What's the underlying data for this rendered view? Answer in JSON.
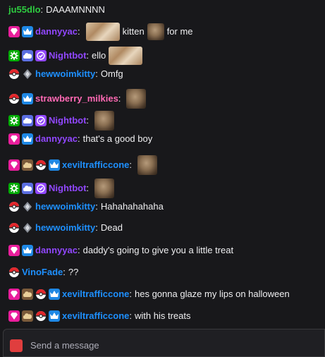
{
  "colors": {
    "background": "#18181b",
    "name_green": "#2ecc40",
    "name_purple": "#9147ff",
    "name_blue": "#1e90ff",
    "name_pink": "#ff69b4",
    "badge_pink": "#e91e9c",
    "badge_blue": "#1e88e5",
    "badge_green": "#00ad03",
    "badge_violet": "#9147ff"
  },
  "messages": [
    {
      "user": "ju55dlo",
      "color": "#2ecc40",
      "badges": [],
      "parts": [
        {
          "t": "text",
          "v": "DAAAMNNNN"
        }
      ]
    },
    {
      "user": "dannyyac",
      "color": "#9147ff",
      "badges": [
        "prime-gem",
        "crown"
      ],
      "parts": [
        {
          "t": "emote",
          "v": "wide"
        },
        {
          "t": "text",
          "v": "kitten"
        },
        {
          "t": "emote",
          "v": "small"
        },
        {
          "t": "text",
          "v": "for me"
        }
      ]
    },
    {
      "user": "Nightbot",
      "color": "#9147ff",
      "badges": [
        "moderator",
        "cloud",
        "verified"
      ],
      "parts": [
        {
          "t": "text",
          "v": "ello"
        },
        {
          "t": "emote",
          "v": "wide"
        }
      ]
    },
    {
      "user": "hewwoimkitty",
      "color": "#1e90ff",
      "badges": [
        "pokeball",
        "diamond-grey"
      ],
      "parts": [
        {
          "t": "text",
          "v": "Omfg"
        }
      ]
    },
    {
      "user": "strawberry_milkies",
      "color": "#ff69b4",
      "badges": [
        "pokeball",
        "crown"
      ],
      "parts": [
        {
          "t": "emote",
          "v": "cat"
        }
      ]
    },
    {
      "user": "Nightbot",
      "color": "#9147ff",
      "badges": [
        "moderator",
        "cloud",
        "verified"
      ],
      "parts": [
        {
          "t": "emote",
          "v": "cat"
        }
      ]
    },
    {
      "user": "dannyyac",
      "color": "#9147ff",
      "badges": [
        "prime-gem",
        "crown"
      ],
      "parts": [
        {
          "t": "text",
          "v": "that's a good boy"
        }
      ]
    },
    {
      "user": "xeviltrafficcone",
      "color": "#1e90ff",
      "badges": [
        "prime-gem",
        "cloud-brown",
        "pokeball",
        "crown"
      ],
      "parts": [
        {
          "t": "emote",
          "v": "cat"
        }
      ]
    },
    {
      "user": "Nightbot",
      "color": "#9147ff",
      "badges": [
        "moderator",
        "cloud",
        "verified"
      ],
      "parts": [
        {
          "t": "emote",
          "v": "cat"
        }
      ]
    },
    {
      "user": "hewwoimkitty",
      "color": "#1e90ff",
      "badges": [
        "pokeball",
        "diamond-grey"
      ],
      "parts": [
        {
          "t": "text",
          "v": "Hahahahahaha"
        }
      ]
    },
    {
      "user": "hewwoimkitty",
      "color": "#1e90ff",
      "badges": [
        "pokeball",
        "diamond-grey"
      ],
      "parts": [
        {
          "t": "text",
          "v": "Dead"
        }
      ]
    },
    {
      "user": "dannyyac",
      "color": "#9147ff",
      "badges": [
        "prime-gem",
        "crown"
      ],
      "parts": [
        {
          "t": "text",
          "v": "daddy's going to give you a little treat"
        }
      ]
    },
    {
      "user": "VinoFade",
      "color": "#1e90ff",
      "badges": [
        "pokeball"
      ],
      "parts": [
        {
          "t": "text",
          "v": "??"
        }
      ]
    },
    {
      "user": "xeviltrafficcone",
      "color": "#1e90ff",
      "badges": [
        "prime-gem",
        "cloud-brown",
        "pokeball",
        "crown"
      ],
      "parts": [
        {
          "t": "text",
          "v": "hes gonna glaze my lips on halloween"
        }
      ]
    },
    {
      "user": "xeviltrafficcone",
      "color": "#1e90ff",
      "badges": [
        "prime-gem",
        "cloud-brown",
        "pokeball",
        "crown"
      ],
      "parts": [
        {
          "t": "text",
          "v": "with his treats"
        }
      ]
    }
  ],
  "input": {
    "placeholder": "Send a message"
  }
}
